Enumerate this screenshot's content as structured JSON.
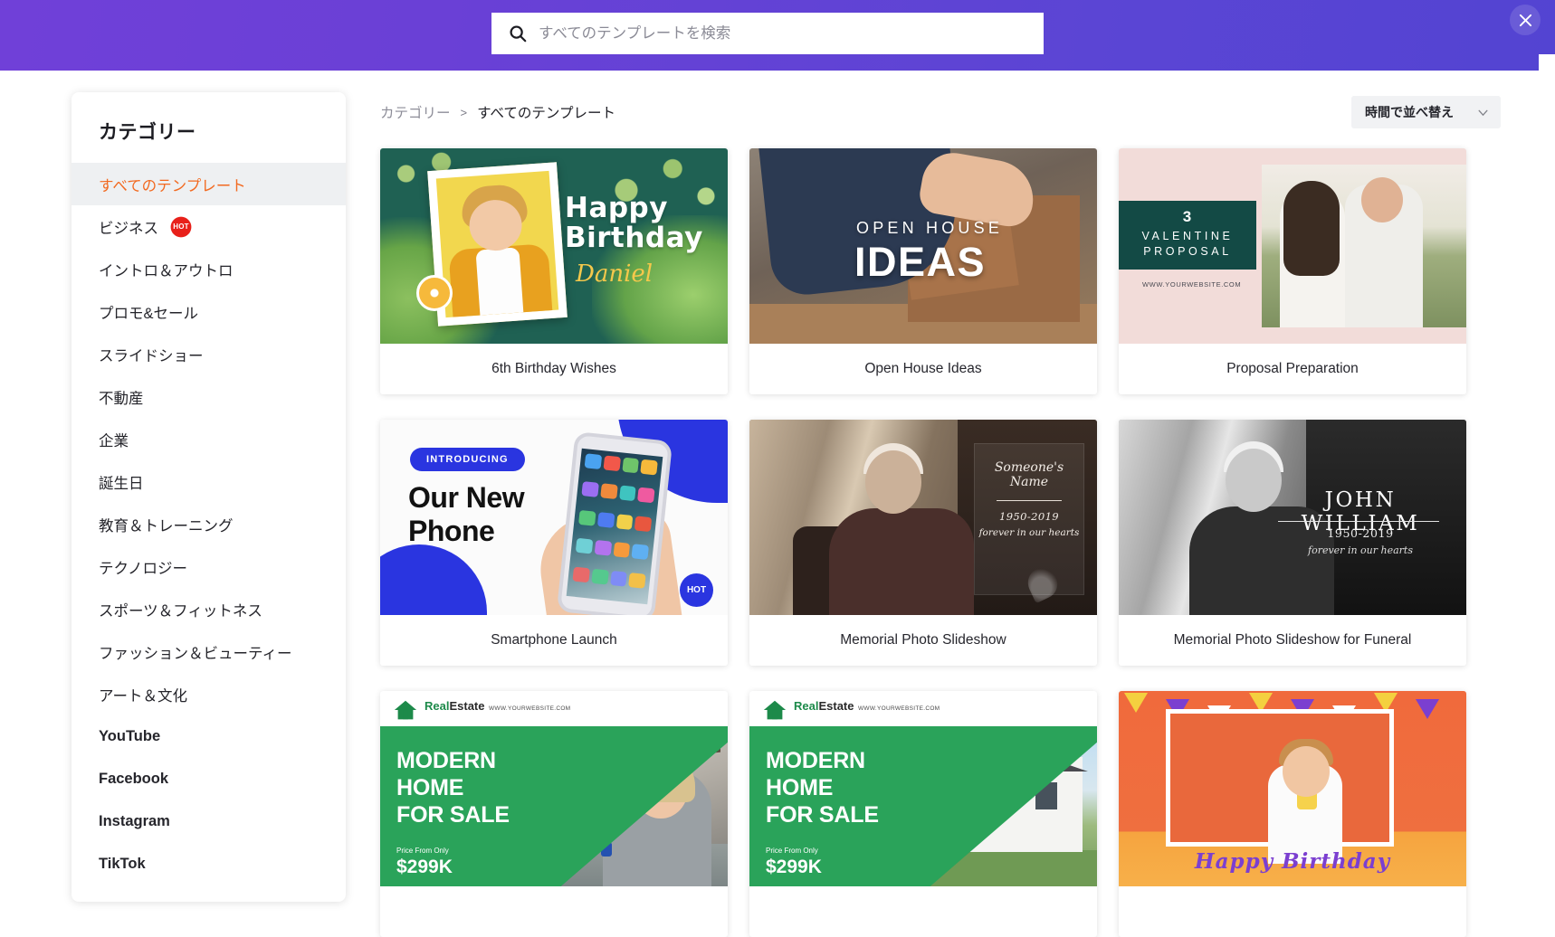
{
  "topbar": {
    "search_placeholder": "すべてのテンプレートを検索",
    "search_value": "",
    "search_icon": "search-icon",
    "close_icon": "close-icon",
    "accent_color": "#6244d4"
  },
  "sidebar": {
    "title": "カテゴリー",
    "active_color": "#f26a21",
    "items": [
      {
        "label": "すべてのテンプレート",
        "active": true,
        "bold": false,
        "badge": ""
      },
      {
        "label": "ビジネス",
        "active": false,
        "bold": false,
        "badge": "HOT"
      },
      {
        "label": "イントロ＆アウトロ",
        "active": false,
        "bold": false,
        "badge": ""
      },
      {
        "label": "プロモ&セール",
        "active": false,
        "bold": false,
        "badge": ""
      },
      {
        "label": "スライドショー",
        "active": false,
        "bold": false,
        "badge": ""
      },
      {
        "label": "不動産",
        "active": false,
        "bold": false,
        "badge": ""
      },
      {
        "label": "企業",
        "active": false,
        "bold": false,
        "badge": ""
      },
      {
        "label": "誕生日",
        "active": false,
        "bold": false,
        "badge": ""
      },
      {
        "label": "教育＆トレーニング",
        "active": false,
        "bold": false,
        "badge": ""
      },
      {
        "label": "テクノロジー",
        "active": false,
        "bold": false,
        "badge": ""
      },
      {
        "label": "スポーツ＆フィットネス",
        "active": false,
        "bold": false,
        "badge": ""
      },
      {
        "label": "ファッション＆ビューティー",
        "active": false,
        "bold": false,
        "badge": ""
      },
      {
        "label": "アート＆文化",
        "active": false,
        "bold": false,
        "badge": ""
      },
      {
        "label": "YouTube",
        "active": false,
        "bold": true,
        "badge": ""
      },
      {
        "label": "Facebook",
        "active": false,
        "bold": true,
        "badge": ""
      },
      {
        "label": "Instagram",
        "active": false,
        "bold": true,
        "badge": ""
      },
      {
        "label": "TikTok",
        "active": false,
        "bold": true,
        "badge": ""
      }
    ]
  },
  "breadcrumb": {
    "root": "カテゴリー",
    "separator": ">",
    "current": "すべてのテンプレート"
  },
  "sort": {
    "label": "時間で並べ替え",
    "chevron_icon": "chevron-down-icon"
  },
  "templates": [
    {
      "title": "6th Birthday Wishes",
      "art": {
        "heading": "Happy\nBirthday",
        "name": "Daniel"
      }
    },
    {
      "title": "Open House Ideas",
      "art": {
        "line1": "OPEN HOUSE",
        "line2": "IDEAS"
      }
    },
    {
      "title": "Proposal Preparation",
      "art": {
        "number": "3",
        "line1": "VALENTINE",
        "line2": "PROPOSAL",
        "url": "WWW.YOURWEBSITE.COM"
      }
    },
    {
      "title": "Smartphone Launch",
      "art": {
        "tag": "INTRODUCING",
        "heading": "Our New\nPhone",
        "badge": "HOT"
      }
    },
    {
      "title": "Memorial Photo Slideshow",
      "art": {
        "name_line1": "Someone's",
        "name_line2": "Name",
        "years": "1950-2019",
        "caption": "forever in our hearts"
      }
    },
    {
      "title": "Memorial Photo Slideshow for Funeral",
      "art": {
        "name": "JOHN WILLIAM",
        "years": "1950-2019",
        "caption": "forever in our hearts"
      }
    },
    {
      "title": "",
      "art": {
        "logo_a": "Real",
        "logo_b": "Estate",
        "logo_url": "WWW.YOURWEBSITE.COM",
        "heading": "MODERN\nHOME\nFOR SALE",
        "price_from": "Price From Only",
        "price": "$299K"
      }
    },
    {
      "title": "",
      "art": {
        "logo_a": "Real",
        "logo_b": "Estate",
        "logo_url": "WWW.YOURWEBSITE.COM",
        "heading": "MODERN\nHOME\nFOR SALE",
        "price_from": "Price From Only",
        "price": "$299K"
      }
    },
    {
      "title": "",
      "art": {
        "heading": "Happy  Birthday"
      }
    }
  ]
}
